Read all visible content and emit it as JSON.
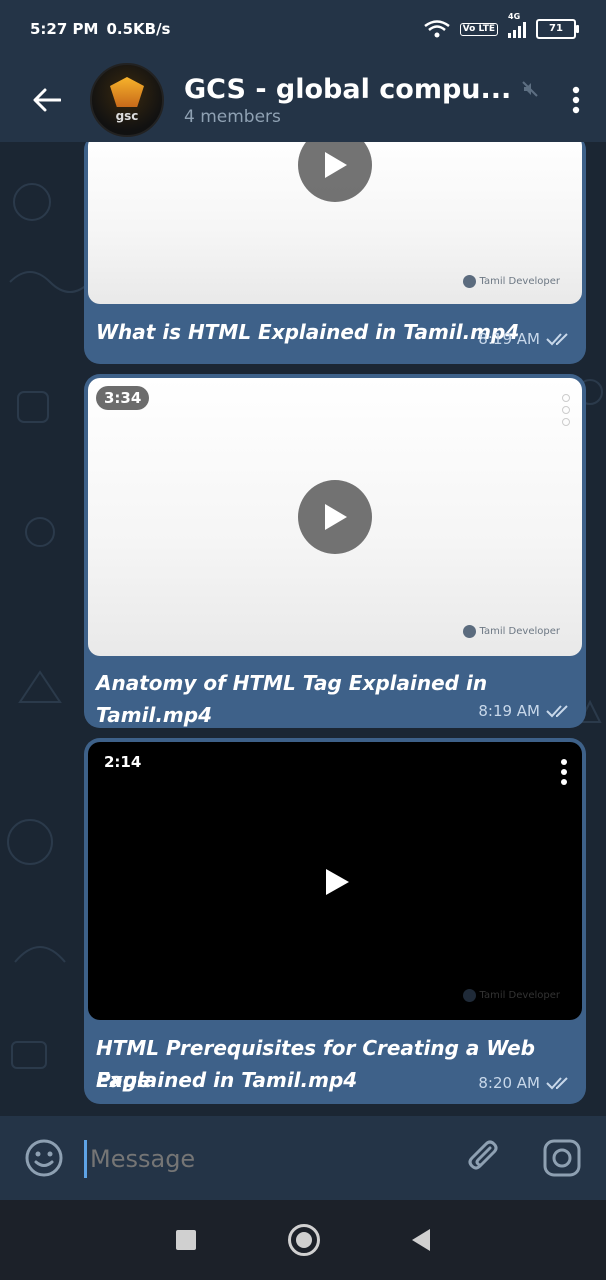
{
  "status": {
    "time": "5:27 PM",
    "speed": "0.5KB/s",
    "network": "4G",
    "lte": "Vo LTE",
    "battery": "71"
  },
  "header": {
    "title": "GCS - global compu...",
    "subtitle": "4 members",
    "avatar_text": "gsc"
  },
  "messages": [
    {
      "caption": "What is HTML Explained in Tamil.mp4",
      "time": "8:19 AM",
      "watermark": "Tamil Developer"
    },
    {
      "caption": "Anatomy of HTML Tag Explained in Tamil.mp4",
      "time": "8:19 AM",
      "duration": "3:34",
      "watermark": "Tamil Developer"
    },
    {
      "caption_line1": "HTML Prerequisites for Creating a Web Page",
      "caption_line2": "Explained in Tamil.mp4",
      "time": "8:20 AM",
      "duration": "2:14",
      "watermark": "Tamil Developer"
    }
  ],
  "input": {
    "placeholder": "Message"
  },
  "colors": {
    "bubble": "#3e6189",
    "header": "#243447",
    "background": "#1b2633"
  }
}
